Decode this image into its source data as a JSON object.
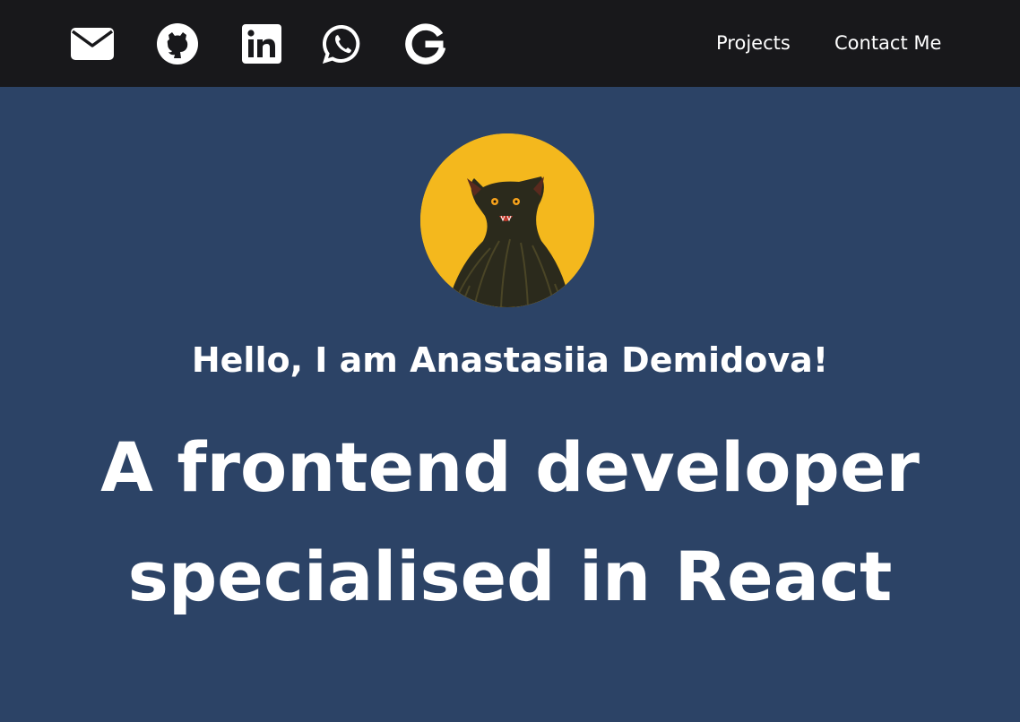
{
  "nav": {
    "icons": [
      {
        "name": "envelope-icon"
      },
      {
        "name": "github-icon"
      },
      {
        "name": "linkedin-icon"
      },
      {
        "name": "whatsapp-icon"
      },
      {
        "name": "google-icon"
      }
    ],
    "links": [
      {
        "label": "Projects"
      },
      {
        "label": "Contact Me"
      }
    ]
  },
  "hero": {
    "greeting": "Hello, I am Anastasiia Demidova!",
    "headline_line1": "A frontend developer",
    "headline_line2": "specialised in React"
  },
  "colors": {
    "navbar_bg": "#18181b",
    "hero_bg": "#2c4366",
    "avatar_bg": "#f4b81d",
    "text": "#ffffff"
  }
}
